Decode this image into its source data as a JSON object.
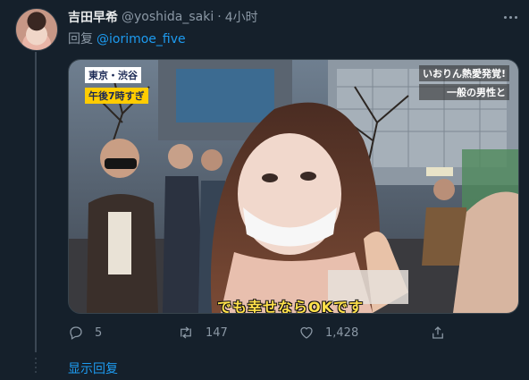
{
  "tweet": {
    "display_name": "吉田早希",
    "handle": "@yoshida_saki",
    "separator": "·",
    "time": "4小时",
    "reply_prefix": "回复",
    "reply_to": "@iorimoe_five",
    "media": {
      "caption_location": "東京・渋谷",
      "caption_time": "午後7時すぎ",
      "caption_right_1": "いおりん熱愛発覚!",
      "caption_right_2": "一般の男性と",
      "subtitle": "でも幸せならOKです"
    },
    "actions": {
      "reply_count": "5",
      "retweet_count": "147",
      "like_count": "1,428"
    }
  },
  "show_replies": "显示回复",
  "colors": {
    "background": "#15202b",
    "secondary_text": "#8b98a5",
    "accent": "#1d9bf0",
    "thread_line": "#3b4754"
  },
  "icons": [
    "more-icon",
    "reply-icon",
    "retweet-icon",
    "like-icon",
    "share-icon"
  ]
}
